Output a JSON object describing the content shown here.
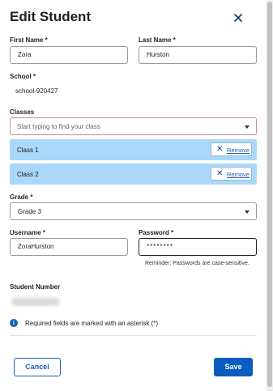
{
  "dialog": {
    "title": "Edit Student",
    "close_icon": "close-icon"
  },
  "first_name": {
    "label": "First Name *",
    "value": "Zora"
  },
  "last_name": {
    "label": "Last Name *",
    "value": "Hurston"
  },
  "school": {
    "label": "School *",
    "value": "school-920427"
  },
  "classes": {
    "label": "Classes",
    "placeholder": "Start typing to find your class",
    "selected": [
      {
        "name": "Class 1",
        "remove_label": "Remove"
      },
      {
        "name": "Class 2",
        "remove_label": "Remove"
      }
    ]
  },
  "grade": {
    "label": "Grade *",
    "value": "Grade 3"
  },
  "username": {
    "label": "Username *",
    "value": "ZoraHurston"
  },
  "password": {
    "label": "Password *",
    "value": "********",
    "hint": "Reminder: Passwords are case-sensitive."
  },
  "student_number": {
    "label": "Student Number"
  },
  "info": {
    "text": "Required fields are marked with an asterisk (*)",
    "icon": "info-icon"
  },
  "actions": {
    "cancel_label": "Cancel",
    "save_label": "Save"
  },
  "colors": {
    "primary": "#0b5cc1",
    "chip_background": "#a9d8fb"
  }
}
